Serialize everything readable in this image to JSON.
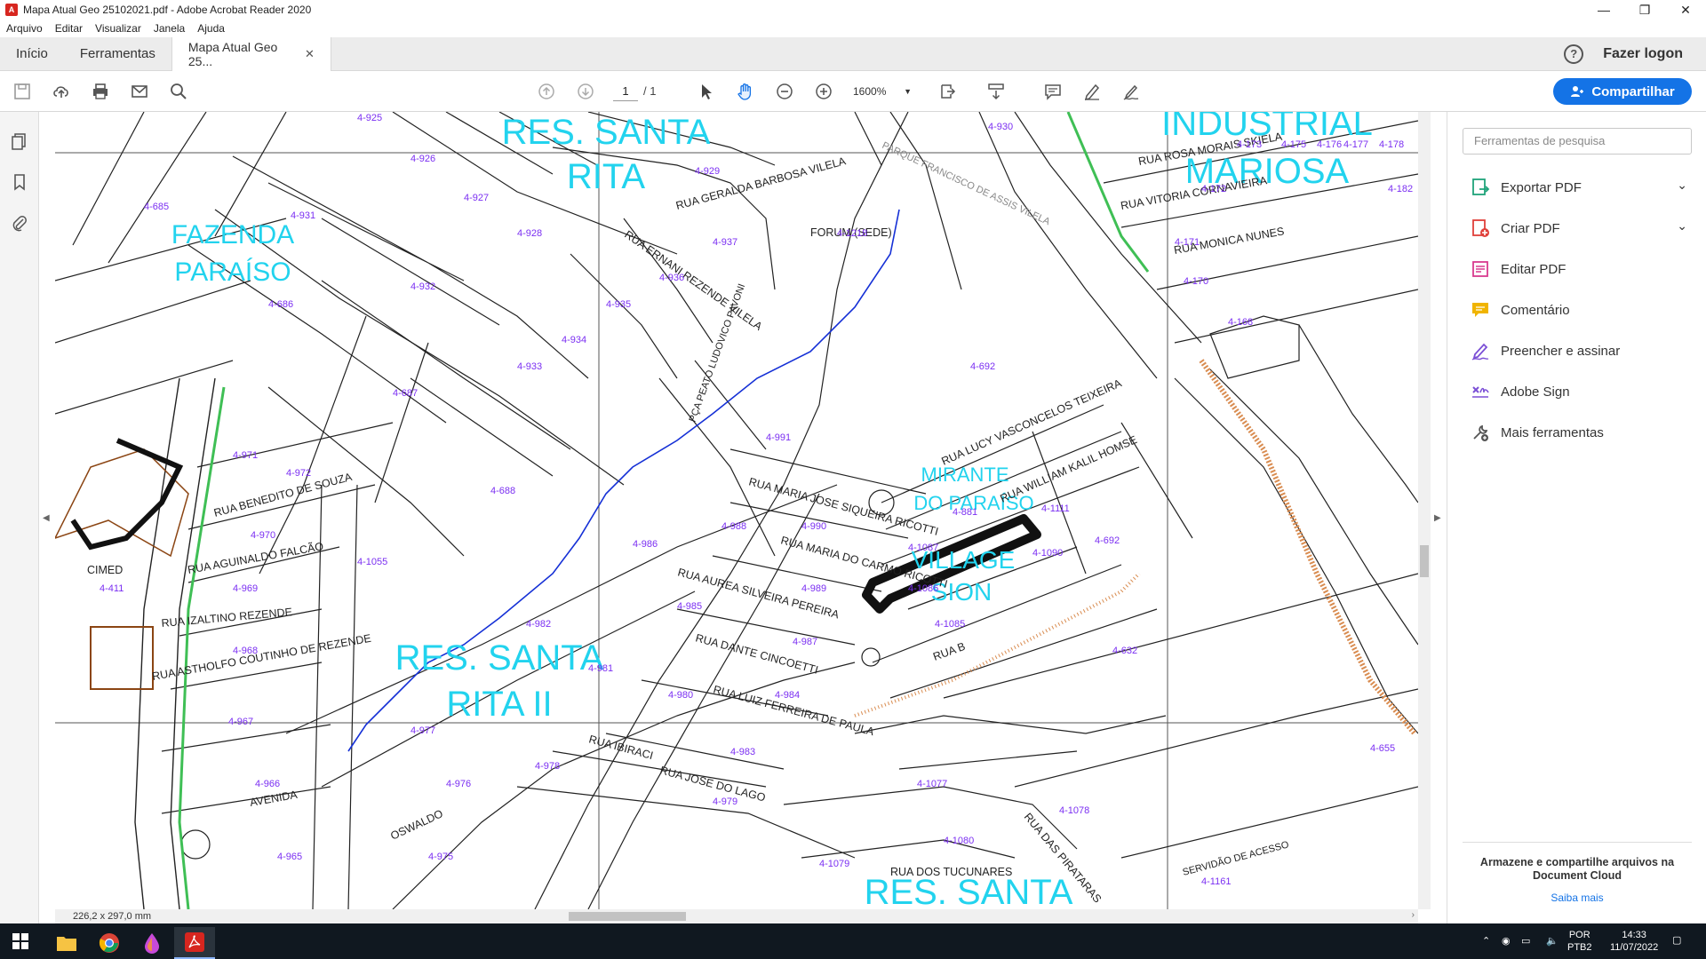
{
  "window": {
    "title": "Mapa Atual Geo 25102021.pdf - Adobe Acrobat Reader 2020",
    "minimize": "—",
    "maximize": "❐",
    "close": "✕"
  },
  "menu": [
    "Arquivo",
    "Editar",
    "Visualizar",
    "Janela",
    "Ajuda"
  ],
  "tabs": {
    "home": "Início",
    "tools": "Ferramentas",
    "document": "Mapa Atual Geo 25...",
    "help": "?",
    "logon": "Fazer logon"
  },
  "toolbar": {
    "page_current": "1",
    "page_total": "/ 1",
    "zoom": "1600%",
    "share_label": "Compartilhar"
  },
  "right_pane": {
    "search_placeholder": "Ferramentas de pesquisa",
    "tools": [
      {
        "label": "Exportar PDF",
        "icon": "export-pdf-icon",
        "color": "#1fa37a"
      },
      {
        "label": "Criar PDF",
        "icon": "create-pdf-icon",
        "color": "#e0403a"
      },
      {
        "label": "Editar PDF",
        "icon": "edit-pdf-icon",
        "color": "#d83b8f"
      },
      {
        "label": "Comentário",
        "icon": "comment-icon",
        "color": "#f0b400"
      },
      {
        "label": "Preencher e assinar",
        "icon": "fill-sign-icon",
        "color": "#7b4fd6"
      },
      {
        "label": "Adobe Sign",
        "icon": "adobe-sign-icon",
        "color": "#7b4fd6"
      },
      {
        "label": "Mais ferramentas",
        "icon": "more-tools-icon",
        "color": "#555555"
      }
    ],
    "doc_cloud_message": "Armazene e compartilhe arquivos na Document Cloud",
    "doc_cloud_link": "Saiba mais"
  },
  "status": {
    "page_size": "226,2 x 297,0 mm"
  },
  "map": {
    "district_labels": [
      "RES. SANTA",
      "RITA",
      "FAZENDA",
      "PARAÍSO",
      "INDUSTRIAL",
      "MARIOSA",
      "RES. SANTA",
      "RITA II",
      "RES. SANTA",
      "MIRANTE",
      "DO PARAÍSO",
      "VILLAGE",
      "SION"
    ],
    "street_labels": [
      "RUA MARIA JOSE SIQUEIRA RICOTTI",
      "RUA MARIA DO CARMO RICOTTI",
      "RUA LUCY VASCONCELOS TEIXEIRA",
      "RUA WILLIAM KALIL HOMSE",
      "RUA AUREA SILVEIRA PEREIRA",
      "RUA DANTE CINCOETTI",
      "RUA LUIZ FERREIRA DE PAULA",
      "RUA JOSE DO LAGO",
      "RUA DAS PIRATARAS",
      "RUA DOS TUCUNARES",
      "RUA IZALTINO REZENDE",
      "RUA ASTHOLFO COUTINHO DE REZENDE",
      "RUA AGUINALDO FALCÃO",
      "RUA BENEDITO DE SOUZA",
      "AVENIDA",
      "FORUM (SEDE)",
      "CIMED",
      "SERVIDÃO DE ACESSO",
      "RUA B",
      "RUA MONICA NUNES",
      "RUA VITORIA CORNAVIEIRA",
      "RUA GERALDA BARBOSA VILELA",
      "RUA ERNANI REZENDE VILELA",
      "RUA ROSA MORAIS SKIELA",
      "PARQUE FRANCISCO DE ASSIS VILELA",
      "PÇA PEATO LUDOVICO PAVONI",
      "RUA IBIRACI",
      "OSWALDO"
    ],
    "lot_labels": [
      "4-925",
      "4-926",
      "4-927",
      "4-928",
      "4-929",
      "4-685",
      "4-931",
      "4-932",
      "4-686",
      "4-687",
      "4-688",
      "4-933",
      "4-934",
      "4-935",
      "4-936",
      "4-937",
      "4-1218",
      "4-692",
      "4-991",
      "4-990",
      "4-989",
      "4-988",
      "4-986",
      "4-985",
      "4-987",
      "4-984",
      "4-983",
      "4-981",
      "4-982",
      "4-980",
      "4-979",
      "4-978",
      "4-977",
      "4-976",
      "4-975",
      "4-971",
      "4-972",
      "4-970",
      "4-969",
      "4-968",
      "4-967",
      "4-966",
      "4-965",
      "4-1055",
      "4-411",
      "4-1077",
      "4-1078",
      "4-1079",
      "4-1080",
      "4-1085",
      "4-1086",
      "4-1087",
      "4-1090",
      "4-1111",
      "4-881",
      "4-692",
      "4-632",
      "4-170",
      "4-168",
      "4-171",
      "4-172",
      "4-173",
      "4-175",
      "4-176",
      "4-177",
      "4-178",
      "4-182",
      "4-655",
      "4-1161",
      "4-930"
    ]
  }
}
